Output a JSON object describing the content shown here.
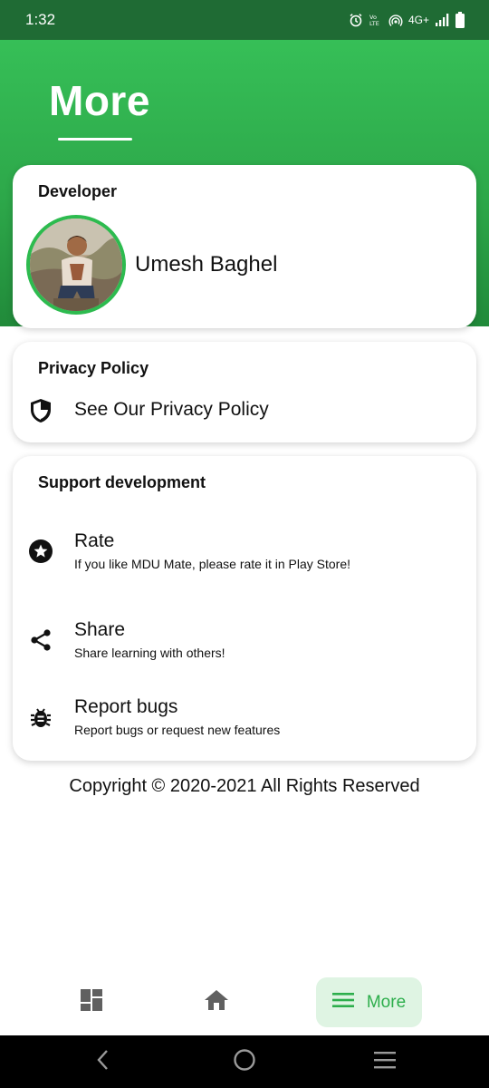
{
  "status_bar": {
    "time": "1:32",
    "network": "4G+",
    "icons": [
      "alarm-icon",
      "volte-icon",
      "hotspot-icon",
      "signal-icon",
      "battery-icon"
    ]
  },
  "header": {
    "title": "More"
  },
  "developer": {
    "section_title": "Developer",
    "name": "Umesh Baghel"
  },
  "privacy": {
    "section_title": "Privacy Policy",
    "item_label": "See Our Privacy Policy",
    "icon": "shield-icon"
  },
  "support": {
    "section_title": "Support development",
    "items": [
      {
        "title": "Rate",
        "subtitle": "If you like MDU Mate, please rate it in Play Store!",
        "icon": "star-icon"
      },
      {
        "title": "Share",
        "subtitle": "Share learning with others!",
        "icon": "share-icon"
      },
      {
        "title": "Report bugs",
        "subtitle": "Report bugs or request new features",
        "icon": "bug-icon"
      }
    ]
  },
  "footer": {
    "copyright": "Copyright © 2020-2021 All Rights Reserved"
  },
  "bottom_nav": {
    "items": [
      {
        "icon": "dashboard-icon"
      },
      {
        "icon": "home-icon"
      },
      {
        "icon": "menu-icon",
        "label": "More",
        "selected": true
      }
    ]
  },
  "colors": {
    "accent": "#2dae4c",
    "header_top": "#36bf57",
    "header_bottom": "#218a3a",
    "status_bar": "#1f6b34",
    "selected_nav_bg": "#dff4e3"
  }
}
